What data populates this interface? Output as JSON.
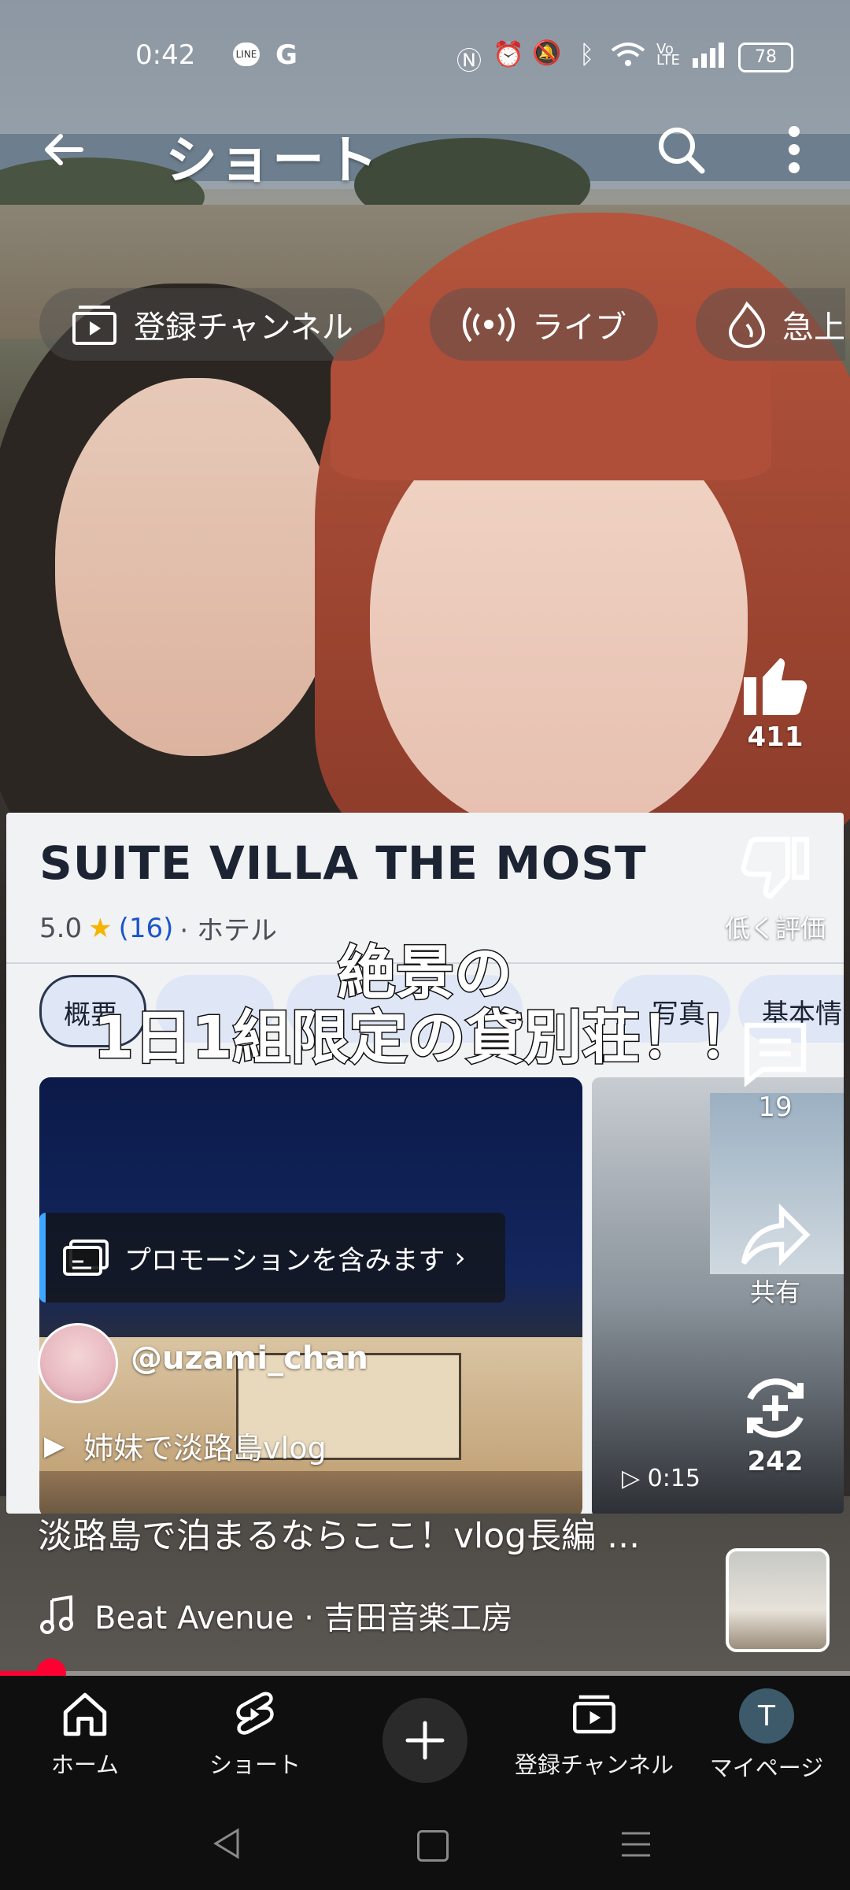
{
  "status_bar": {
    "time": "0:42",
    "battery": "78"
  },
  "top_bar": {
    "title": "ショート"
  },
  "chips": [
    {
      "label": "登録チャンネル",
      "icon": "subscriptions-icon"
    },
    {
      "label": "ライブ",
      "icon": "live-icon"
    },
    {
      "label": "急上",
      "icon": "trending-icon"
    }
  ],
  "card": {
    "place_name": "SUITE VILLA THE MOST",
    "rating": "5.0",
    "review_count": "(16)",
    "category": "· ホテル",
    "tabs": [
      "概要",
      "",
      "",
      "写真",
      "基本情"
    ],
    "promotion_label": "プロモーションを含みます",
    "duration": "0:15"
  },
  "caption": {
    "line1": "絶景の",
    "line2": "1日1組限定の貸別荘！！"
  },
  "actions": {
    "likes": "411",
    "dislike_label": "低く評価",
    "comments": "19",
    "share_label": "共有",
    "remix": "242"
  },
  "channel": {
    "handle": "@uzami_chan",
    "playlist": "姉妹で淡路島vlog"
  },
  "video": {
    "title": "淡路島で泊まるならここ！vlog長編 ...",
    "music": "Beat Avenue · 吉田音楽工房",
    "progress": 0.06
  },
  "bottom_nav": {
    "home": "ホーム",
    "shorts": "ショート",
    "subscriptions": "登録チャンネル",
    "mypage": "マイページ",
    "avatar_letter": "T"
  },
  "colors": {
    "accent_red": "#ff0033",
    "rating_link": "#1a56c8",
    "star": "#f4b400",
    "pill_bg": "#dfe6f6",
    "night_sky": "#0e1d4e"
  }
}
